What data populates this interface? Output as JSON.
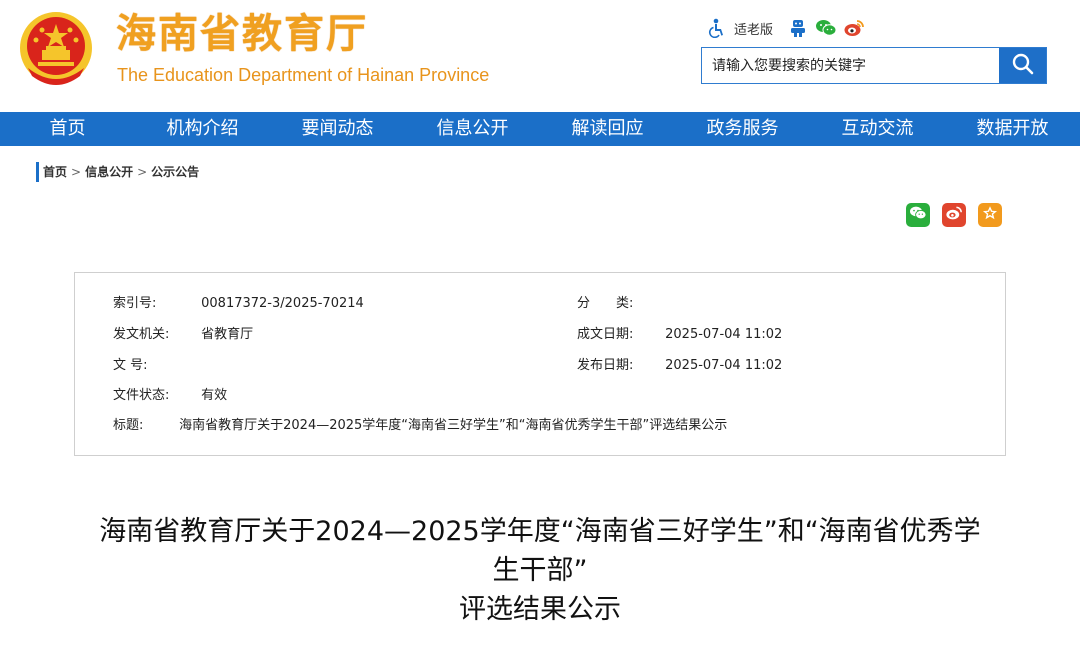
{
  "header": {
    "title": "海南省教育厅",
    "subtitle": "The Education Department of Hainan Province",
    "elder_mode_label": "适老版",
    "search_placeholder": "请输入您要搜索的关键字"
  },
  "nav": {
    "items": [
      "首页",
      "机构介绍",
      "要闻动态",
      "信息公开",
      "解读回应",
      "政务服务",
      "互动交流",
      "数据开放"
    ]
  },
  "breadcrumb": {
    "items": [
      "首页",
      "信息公开",
      "公示公告"
    ],
    "separator": ">"
  },
  "meta": {
    "index_label": "索引号:",
    "index_value": "00817372-3/2025-70214",
    "category_label": "分　　类:",
    "category_value": "",
    "issuer_label": "发文机关:",
    "issuer_value": "省教育厅",
    "doc_date_label": "成文日期:",
    "doc_date_value": "2025-07-04 11:02",
    "doc_no_label": "文    号:",
    "doc_no_value": "",
    "pub_date_label": "发布日期:",
    "pub_date_value": "2025-07-04 11:02",
    "status_label": "文件状态:",
    "status_value": "有效",
    "title_label": "标题:",
    "title_value": "海南省教育厅关于2024—2025学年度“海南省三好学生”和“海南省优秀学生干部”评选结果公示"
  },
  "article": {
    "title_line1": "海南省教育厅关于2024—2025学年度“海南省三好学生”和“海南省优秀学",
    "title_line2": "生干部”",
    "title_line3": "评选结果公示"
  },
  "colors": {
    "brand_blue": "#1b6fc8",
    "title_orange": "#f0a020",
    "wechat_green": "#2aae3c",
    "weibo_red": "#e0452d",
    "favorite_orange": "#f29a1d"
  },
  "icons": [
    "national-emblem-icon",
    "accessibility-icon",
    "robot-icon",
    "wechat-icon",
    "weibo-icon",
    "search-icon",
    "star-icon"
  ]
}
